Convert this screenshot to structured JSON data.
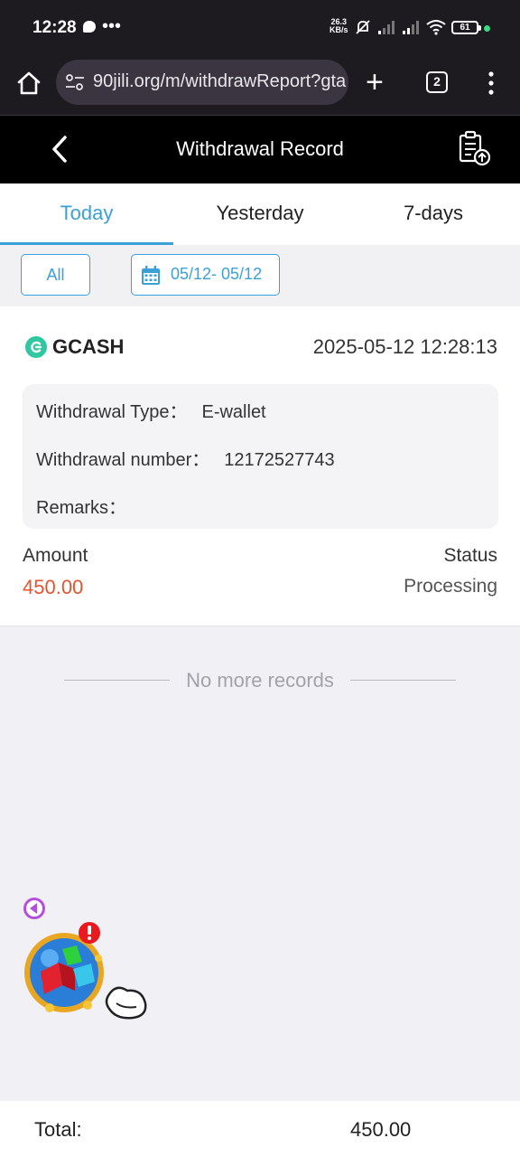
{
  "status_bar": {
    "time": "12:28",
    "net_speed": "26.3",
    "net_unit": "KB/s",
    "battery": "61"
  },
  "browser": {
    "url": "90jili.org/m/withdrawReport?gta",
    "tab_count": "2"
  },
  "header": {
    "title": "Withdrawal Record"
  },
  "tabs": [
    {
      "label": "Today",
      "active": true
    },
    {
      "label": "Yesterday",
      "active": false
    },
    {
      "label": "7-days",
      "active": false
    }
  ],
  "filters": {
    "all_label": "All",
    "date_range": "05/12- 05/12"
  },
  "record": {
    "method": "GCASH",
    "datetime": "2025-05-12 12:28:13",
    "type_label": "Withdrawal Type：",
    "type_value": "E-wallet",
    "number_label": "Withdrawal number：",
    "number_value": "12172527743",
    "remarks_label": "Remarks：",
    "remarks_value": "",
    "amount_label": "Amount",
    "amount_value": "450.00",
    "status_label": "Status",
    "status_value": "Processing"
  },
  "no_more": "No more records",
  "footer": {
    "total_label": "Total:",
    "total_value": "450.00"
  },
  "colors": {
    "accent": "#3aa0d8",
    "amount": "#e5532f",
    "header_bg": "#000000",
    "system_bar_bg": "#1d1a20"
  }
}
